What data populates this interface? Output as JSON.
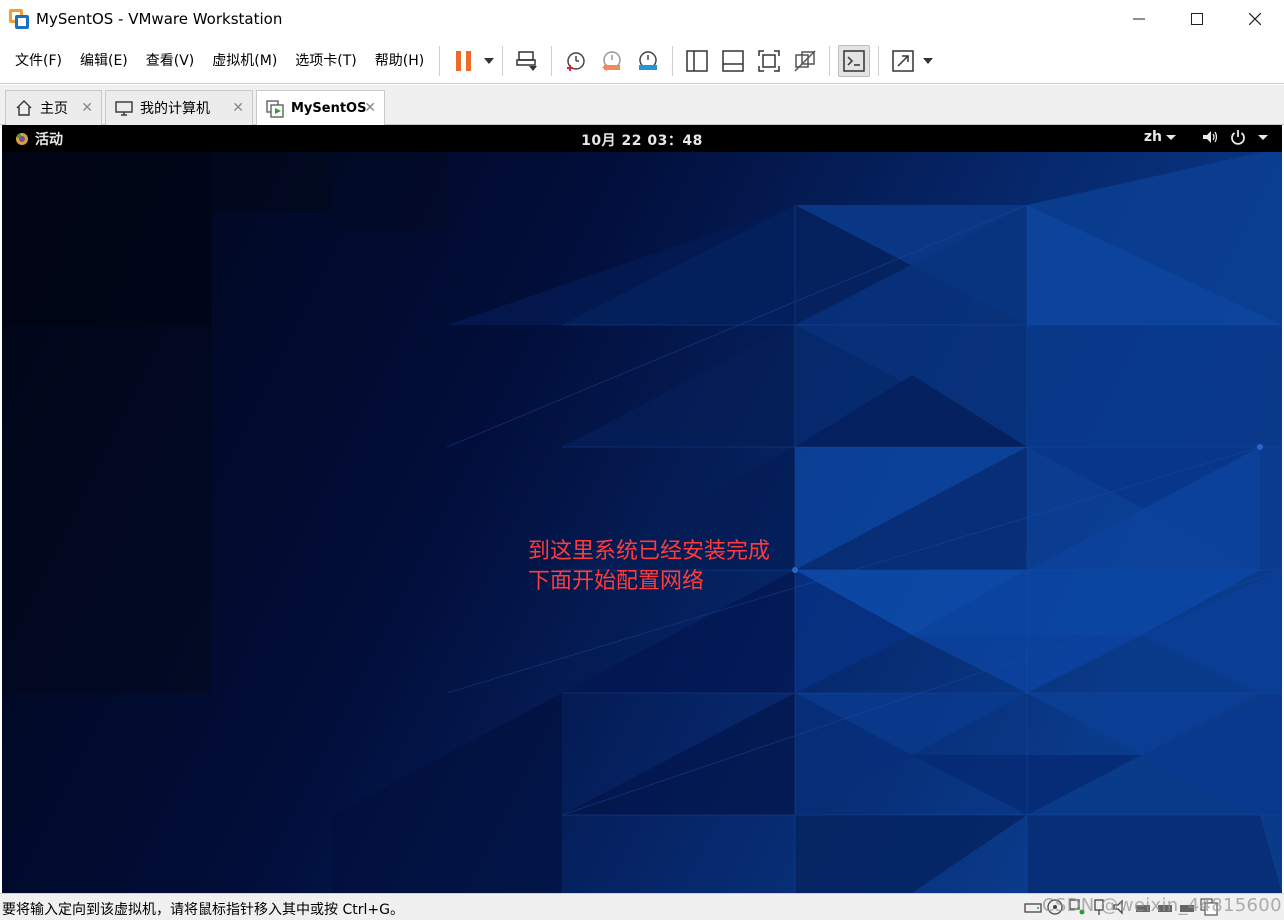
{
  "window": {
    "title": "MySentOS - VMware Workstation"
  },
  "menu": {
    "items": [
      "文件(F)",
      "编辑(E)",
      "查看(V)",
      "虚拟机(M)",
      "选项卡(T)",
      "帮助(H)"
    ]
  },
  "tabs": [
    {
      "label": "主页",
      "icon": "home-icon",
      "active": false
    },
    {
      "label": "我的计算机",
      "icon": "monitor-icon",
      "active": false
    },
    {
      "label": "MySentOS",
      "icon": "vm-running-icon",
      "active": true
    }
  ],
  "gnome": {
    "activities": "活动",
    "clock": "10月 22  03：48",
    "language": "zh"
  },
  "annotation": {
    "line1": "到这里系统已经安装完成",
    "line2": "下面开始配置网络"
  },
  "statusbar": {
    "message": "要将输入定向到该虚拟机，请将鼠标指针移入其中或按 Ctrl+G。"
  },
  "watermark": "CSDN @weixin_44815600",
  "colors": {
    "pause_orange": "#ee6a2a",
    "annotation_red": "#ff3b3b",
    "desktop_dark": "#000a2e",
    "desktop_blue": "#0b3c8c"
  }
}
